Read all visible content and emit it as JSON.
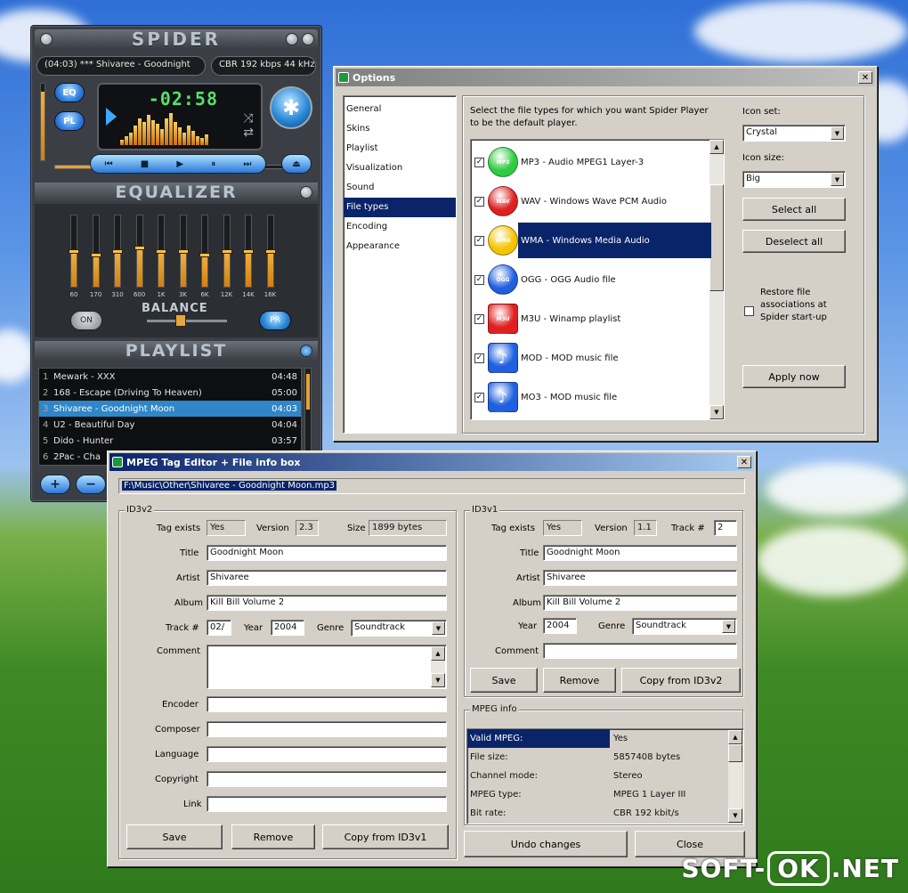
{
  "spider": {
    "title": "SPIDER",
    "now_playing": "(04:03) *** Shivaree - Goodnight",
    "bitrate": "CBR 192 kbps 44 kHz",
    "time": "-02:58",
    "btn_eq": "EQ",
    "btn_pl": "PL",
    "transport": [
      "⏮",
      "■",
      "▶",
      "⏸",
      "⏭"
    ],
    "eject": "⏏",
    "seek_progress": 0.32,
    "volume_level": 0.9,
    "equalizer_title": "EQUALIZER",
    "eq_bands": [
      "60",
      "170",
      "310",
      "600",
      "1K",
      "3K",
      "6K",
      "12K",
      "14K",
      "16K"
    ],
    "eq_levels": [
      0.5,
      0.45,
      0.5,
      0.55,
      0.5,
      0.5,
      0.45,
      0.5,
      0.5,
      0.5
    ],
    "eq_left_btn": "ON",
    "eq_right_btn": "PR",
    "balance": "BALANCE",
    "playlist_title": "PLAYLIST",
    "playlist": [
      {
        "num": "1",
        "name": "Mewark - XXX",
        "dur": "04:48"
      },
      {
        "num": "2",
        "name": "168 - Escape (Driving To Heaven)",
        "dur": "05:00"
      },
      {
        "num": "3",
        "name": "Shivaree - Goodnight Moon",
        "dur": "04:03"
      },
      {
        "num": "4",
        "name": "U2 - Beautiful Day",
        "dur": "04:04"
      },
      {
        "num": "5",
        "name": "Dido - Hunter",
        "dur": "03:57"
      },
      {
        "num": "6",
        "name": "2Pac - Cha",
        "dur": ""
      }
    ],
    "add": "+",
    "remove": "−"
  },
  "options": {
    "title": "Options",
    "categories": [
      "General",
      "Skins",
      "Playlist",
      "Visualization",
      "Sound",
      "File types",
      "Encoding",
      "Appearance"
    ],
    "selected_category": 5,
    "instructions": "Select the file types for which you want Spider Player to be the default player.",
    "file_types": [
      {
        "label": "MP3 - Audio MPEG1 Layer-3",
        "icon_text": "MP3",
        "color": "#2ecc40",
        "shape": "circle"
      },
      {
        "label": "WAV - Windows Wave PCM Audio",
        "icon_text": "WAV",
        "color": "#e02020",
        "shape": "circle"
      },
      {
        "label": "WMA - Windows Media Audio",
        "icon_text": "WMA",
        "color": "#f5c400",
        "shape": "circle"
      },
      {
        "label": "OGG - OGG Audio file",
        "icon_text": "OGG",
        "color": "#1f5fe0",
        "shape": "circle"
      },
      {
        "label": "M3U - Winamp playlist",
        "icon_text": "M3U",
        "color": "#e02020",
        "shape": "square"
      },
      {
        "label": "MOD - MOD music file",
        "icon_text": "♪",
        "color": "#1f5fe0",
        "shape": "square"
      },
      {
        "label": "MO3 - MOD music file",
        "icon_text": "♪",
        "color": "#1f5fe0",
        "shape": "square"
      }
    ],
    "selected_file_type": 2,
    "icon_set_label": "Icon set:",
    "icon_set_value": "Crystal",
    "icon_size_label": "Icon size:",
    "icon_size_value": "Big",
    "select_all": "Select all",
    "deselect_all": "Deselect all",
    "restore_label": "Restore file associations at Spider start-up",
    "apply_now": "Apply now"
  },
  "tag_editor": {
    "title": "MPEG Tag Editor + File info box",
    "path": "F:\\Music\\Other\\Shivaree - Goodnight Moon.mp3",
    "id3v2": {
      "group": "ID3v2",
      "tag_exists_label": "Tag exists",
      "tag_exists": "Yes",
      "version_label": "Version",
      "version": "2.3",
      "size_label": "Size",
      "size": "1899 bytes",
      "title_label": "Title",
      "title": "Goodnight Moon",
      "artist_label": "Artist",
      "artist": "Shivaree",
      "album_label": "Album",
      "album": "Kill Bill Volume 2",
      "track_label": "Track #",
      "track": "02/",
      "year_label": "Year",
      "year": "2004",
      "genre_label": "Genre",
      "genre": "Soundtrack",
      "comment_label": "Comment",
      "comment": "",
      "encoder_label": "Encoder",
      "encoder": "",
      "composer_label": "Composer",
      "composer": "",
      "language_label": "Language",
      "language": "",
      "copyright_label": "Copyright",
      "copyright": "",
      "link_label": "Link",
      "link": "",
      "save": "Save",
      "remove": "Remove",
      "copy": "Copy from ID3v1"
    },
    "id3v1": {
      "group": "ID3v1",
      "tag_exists_label": "Tag exists",
      "tag_exists": "Yes",
      "version_label": "Version",
      "version": "1.1",
      "track_label": "Track #",
      "track": "2",
      "title_label": "Title",
      "title": "Goodnight Moon",
      "artist_label": "Artist",
      "artist": "Shivaree",
      "album_label": "Album",
      "album": "Kill Bill Volume 2",
      "year_label": "Year",
      "year": "2004",
      "genre_label": "Genre",
      "genre": "Soundtrack",
      "comment_label": "Comment",
      "comment": "",
      "save": "Save",
      "remove": "Remove",
      "copy": "Copy from ID3v2"
    },
    "mpeg_info": {
      "group": "MPEG info",
      "rows": [
        {
          "k": "Valid MPEG:",
          "v": "Yes"
        },
        {
          "k": "File size:",
          "v": "5857408 bytes"
        },
        {
          "k": "Channel mode:",
          "v": "Stereo"
        },
        {
          "k": "MPEG type:",
          "v": "MPEG 1 Layer III"
        },
        {
          "k": "Bit rate:",
          "v": "CBR 192 kbit/s"
        }
      ]
    },
    "undo": "Undo changes",
    "close": "Close"
  },
  "watermark": {
    "left": "SOFT-",
    "box": "OK",
    "right": ".NET"
  }
}
